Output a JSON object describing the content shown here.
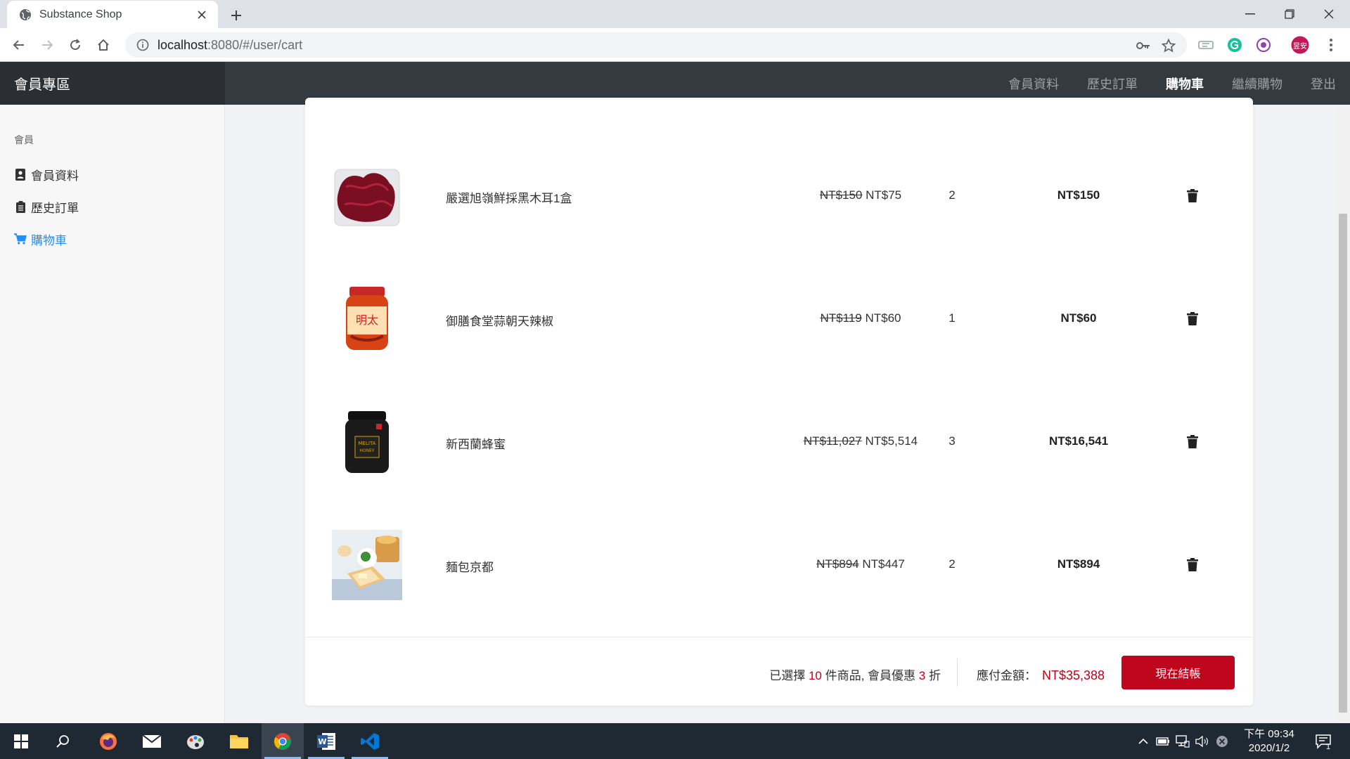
{
  "browser": {
    "tab_title": "Substance Shop",
    "url_host": "localhost",
    "url_path": ":8080/#/user/cart",
    "profile_initials": "昱安"
  },
  "header": {
    "brand": "會員專區",
    "nav": [
      "會員資料",
      "歷史訂單",
      "購物車",
      "繼續購物",
      "登出"
    ],
    "active_nav": "購物車"
  },
  "sidebar": {
    "heading": "會員",
    "items": [
      {
        "label": "會員資料",
        "icon": "id-card-icon"
      },
      {
        "label": "歷史訂單",
        "icon": "clipboard-icon"
      },
      {
        "label": "購物車",
        "icon": "shopping-cart-icon"
      }
    ]
  },
  "cart": {
    "items": [
      {
        "name": "嚴選旭嶺鮮採黑木耳1盒",
        "old_price": "NT$150",
        "price": "NT$75",
        "qty": "2",
        "subtotal": "NT$150"
      },
      {
        "name": "御膳食堂蒜朝天辣椒",
        "old_price": "NT$119",
        "price": "NT$60",
        "qty": "1",
        "subtotal": "NT$60"
      },
      {
        "name": "新西蘭蜂蜜",
        "old_price": "NT$11,027",
        "price": "NT$5,514",
        "qty": "3",
        "subtotal": "NT$16,541"
      },
      {
        "name": "麵包京都",
        "old_price": "NT$894",
        "price": "NT$447",
        "qty": "2",
        "subtotal": "NT$894"
      }
    ],
    "summary": {
      "prefix": "已選擇",
      "count": "10",
      "mid": "件商品, 會員優惠",
      "discount": "3",
      "suffix": "折"
    },
    "payable_label": "應付金額：",
    "payable_amount": "NT$35,388",
    "checkout_label": "現在結帳"
  },
  "taskbar": {
    "time": "下午 09:34",
    "date": "2020/1/2",
    "notification_count": "1"
  },
  "colors": {
    "accent": "#c0061c",
    "link_active": "#1e90ff",
    "header_bg": "#343a40"
  }
}
